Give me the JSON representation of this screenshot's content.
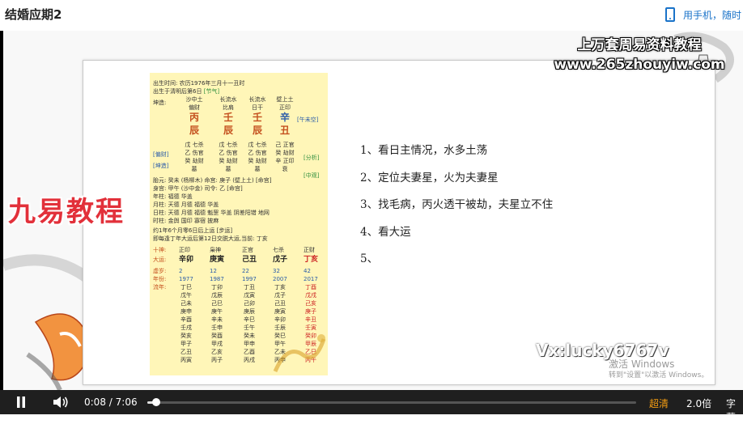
{
  "header": {
    "title": "结婚应期2",
    "mobile_link": "用手机，随时"
  },
  "watermarks": {
    "top_line1": "上万套周易资料教程",
    "top_line2": "www.265zhouyiw.com",
    "brand": "九易教程",
    "contact": "Vx:lucky6767v",
    "activate_title": "激活 Windows",
    "activate_hint": "转到\"设置\"以激活 Windows。"
  },
  "chart": {
    "birth_line1": "出生时间: 农历1976年三月十一丑时",
    "birth_line2": "出生于清明后第6日",
    "birth_tag": "[节气]",
    "gender": "坤造:",
    "nayin": [
      "沙中土",
      "长流水",
      "长流水",
      "壁上土"
    ],
    "ten_gods_top": [
      "偏财",
      "比肩",
      "日干",
      "正印"
    ],
    "stems": [
      "丙",
      "壬",
      "壬",
      "辛"
    ],
    "branches": [
      "辰",
      "辰",
      "辰",
      "丑"
    ],
    "void_tag": "[午未空]",
    "hidden_row1": [
      "戊 七杀",
      "戊 七杀",
      "戊 七杀",
      "己 正官"
    ],
    "hidden_row2": [
      "乙 伤官",
      "乙 伤官",
      "乙 伤官",
      "癸 劫财"
    ],
    "hidden_row3": [
      "癸 劫财",
      "癸 劫财",
      "癸 劫财",
      "辛 正印"
    ],
    "growth": [
      "墓",
      "墓",
      "墓",
      "衰"
    ],
    "side_tags": [
      "[偏财]",
      "[坤造]",
      "[分析]",
      "[中观]"
    ],
    "info_lines": [
      "胎元: 癸未 (杨柳木)  命宫: 庚子 (壁上土)  [命宫]",
      "身宫: 甲午 (沙中金)  司令: 乙 [命宫]",
      "年柱: 福德 华盖",
      "月柱: 天德 月德 福德 华盖",
      "日柱: 天德 月德 福德 魁罡 华盖 阴差阳错 地网",
      "时柱: 金舆 国印 寡宿 披麻",
      "约1年6个月零6日后上运 [步运]",
      "即每逢丁年大运后第12日交脱大运,当前: 丁亥"
    ],
    "dayun_header": [
      "十神:",
      "正印",
      "枭神",
      "正官",
      "七杀",
      "正财"
    ],
    "dayun_pillars": [
      "大运:",
      "辛卯",
      "庚寅",
      "己丑",
      "戊子",
      "丁亥"
    ],
    "dayun_ages": [
      "虚岁:",
      "2",
      "12",
      "22",
      "32",
      "42"
    ],
    "dayun_years": [
      "年份:",
      "1977",
      "1987",
      "1997",
      "2007",
      "2017"
    ],
    "liunian_label": "流年:",
    "liunian_rows": [
      [
        "丁巳",
        "丁卯",
        "丁丑",
        "丁亥",
        "丁酉"
      ],
      [
        "戊午",
        "戊辰",
        "戊寅",
        "戊子",
        "戊戌"
      ],
      [
        "己未",
        "己巳",
        "己卯",
        "己丑",
        "己亥"
      ],
      [
        "庚申",
        "庚午",
        "庚辰",
        "庚寅",
        "庚子"
      ],
      [
        "辛酉",
        "辛未",
        "辛巳",
        "辛卯",
        "辛丑"
      ],
      [
        "壬戌",
        "壬申",
        "壬午",
        "壬辰",
        "壬寅"
      ],
      [
        "癸亥",
        "癸酉",
        "癸未",
        "癸巳",
        "癸卯"
      ],
      [
        "甲子",
        "甲戌",
        "甲申",
        "甲午",
        "甲辰"
      ],
      [
        "乙丑",
        "乙亥",
        "乙酉",
        "乙未",
        "乙巳"
      ],
      [
        "丙寅",
        "丙子",
        "丙戌",
        "丙申",
        "丙午"
      ]
    ]
  },
  "slide": {
    "points": [
      "1、看日主情况，水多土荡",
      "2、定位夫妻星，火为夫妻星",
      "3、找毛病，丙火透干被劫，夫星立不住",
      "4、看大运",
      "5、"
    ]
  },
  "player": {
    "current_time": "0:08",
    "separator": "/",
    "duration": "7:06",
    "progress_fraction": 0.019,
    "quality": "超清",
    "speed": "2.0倍",
    "subtitle": "字幕",
    "colors": {
      "accent": "#f39c12",
      "bar": "#1f1f1f",
      "link": "#1a73c9"
    }
  }
}
